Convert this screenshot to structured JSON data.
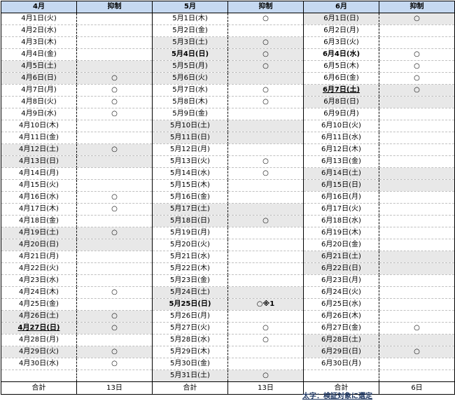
{
  "headers": [
    "4月",
    "抑制",
    "5月",
    "抑制",
    "6月",
    "抑制"
  ],
  "months": [
    {
      "rows": [
        {
          "date": "4月1日(火)",
          "mark": "",
          "gray": false
        },
        {
          "date": "4月2日(水)",
          "mark": "",
          "gray": false
        },
        {
          "date": "4月3日(木)",
          "mark": "",
          "gray": false
        },
        {
          "date": "4月4日(金)",
          "mark": "",
          "gray": false
        },
        {
          "date": "4月5日(土)",
          "mark": "",
          "gray": true
        },
        {
          "date": "4月6日(日)",
          "mark": "○",
          "gray": true
        },
        {
          "date": "4月7日(月)",
          "mark": "○",
          "gray": false
        },
        {
          "date": "4月8日(火)",
          "mark": "○",
          "gray": false
        },
        {
          "date": "4月9日(水)",
          "mark": "○",
          "gray": false
        },
        {
          "date": "4月10日(木)",
          "mark": "",
          "gray": false
        },
        {
          "date": "4月11日(金)",
          "mark": "",
          "gray": false
        },
        {
          "date": "4月12日(土)",
          "mark": "○",
          "gray": true
        },
        {
          "date": "4月13日(日)",
          "mark": "",
          "gray": true
        },
        {
          "date": "4月14日(月)",
          "mark": "",
          "gray": false
        },
        {
          "date": "4月15日(火)",
          "mark": "",
          "gray": false
        },
        {
          "date": "4月16日(水)",
          "mark": "○",
          "gray": false
        },
        {
          "date": "4月17日(木)",
          "mark": "○",
          "gray": false
        },
        {
          "date": "4月18日(金)",
          "mark": "",
          "gray": false
        },
        {
          "date": "4月19日(土)",
          "mark": "○",
          "gray": true
        },
        {
          "date": "4月20日(日)",
          "mark": "",
          "gray": true
        },
        {
          "date": "4月21日(月)",
          "mark": "",
          "gray": false
        },
        {
          "date": "4月22日(火)",
          "mark": "",
          "gray": false
        },
        {
          "date": "4月23日(水)",
          "mark": "",
          "gray": false
        },
        {
          "date": "4月24日(木)",
          "mark": "○",
          "gray": false
        },
        {
          "date": "4月25日(金)",
          "mark": "",
          "gray": false
        },
        {
          "date": "4月26日(土)",
          "mark": "○",
          "gray": true
        },
        {
          "date": "4月27日(日)",
          "mark": "○",
          "gray": true,
          "bold": true,
          "underline": true
        },
        {
          "date": "4月28日(月)",
          "mark": "",
          "gray": false
        },
        {
          "date": "4月29日(火)",
          "mark": "○",
          "gray": true
        },
        {
          "date": "4月30日(水)",
          "mark": "○",
          "gray": false
        },
        {
          "date": "",
          "mark": "",
          "gray": false
        }
      ]
    },
    {
      "rows": [
        {
          "date": "5月1日(木)",
          "mark": "○",
          "gray": false
        },
        {
          "date": "5月2日(金)",
          "mark": "",
          "gray": false
        },
        {
          "date": "5月3日(土)",
          "mark": "○",
          "gray": true
        },
        {
          "date": "5月4日(日)",
          "mark": "○",
          "gray": true,
          "bold": true
        },
        {
          "date": "5月5日(月)",
          "mark": "○",
          "gray": true
        },
        {
          "date": "5月6日(火)",
          "mark": "",
          "gray": true
        },
        {
          "date": "5月7日(水)",
          "mark": "○",
          "gray": false
        },
        {
          "date": "5月8日(木)",
          "mark": "○",
          "gray": false
        },
        {
          "date": "5月9日(金)",
          "mark": "",
          "gray": false
        },
        {
          "date": "5月10日(土)",
          "mark": "",
          "gray": true
        },
        {
          "date": "5月11日(日)",
          "mark": "",
          "gray": true
        },
        {
          "date": "5月12日(月)",
          "mark": "",
          "gray": false
        },
        {
          "date": "5月13日(火)",
          "mark": "○",
          "gray": false
        },
        {
          "date": "5月14日(水)",
          "mark": "○",
          "gray": false
        },
        {
          "date": "5月15日(木)",
          "mark": "",
          "gray": false
        },
        {
          "date": "5月16日(金)",
          "mark": "",
          "gray": false
        },
        {
          "date": "5月17日(土)",
          "mark": "",
          "gray": true
        },
        {
          "date": "5月18日(日)",
          "mark": "○",
          "gray": true
        },
        {
          "date": "5月19日(月)",
          "mark": "",
          "gray": false
        },
        {
          "date": "5月20日(火)",
          "mark": "",
          "gray": false
        },
        {
          "date": "5月21日(水)",
          "mark": "",
          "gray": false
        },
        {
          "date": "5月22日(木)",
          "mark": "",
          "gray": false
        },
        {
          "date": "5月23日(金)",
          "mark": "",
          "gray": false
        },
        {
          "date": "5月24日(土)",
          "mark": "",
          "gray": true
        },
        {
          "date": "5月25日(日)",
          "mark": "○※1",
          "gray": true,
          "bold": true
        },
        {
          "date": "5月26日(月)",
          "mark": "",
          "gray": false
        },
        {
          "date": "5月27日(火)",
          "mark": "○",
          "gray": false
        },
        {
          "date": "5月28日(水)",
          "mark": "○",
          "gray": false
        },
        {
          "date": "5月29日(木)",
          "mark": "",
          "gray": false
        },
        {
          "date": "5月30日(金)",
          "mark": "",
          "gray": false
        },
        {
          "date": "5月31日(土)",
          "mark": "○",
          "gray": true
        }
      ]
    },
    {
      "rows": [
        {
          "date": "6月1日(日)",
          "mark": "○",
          "gray": true
        },
        {
          "date": "6月2日(月)",
          "mark": "",
          "gray": false
        },
        {
          "date": "6月3日(火)",
          "mark": "",
          "gray": false
        },
        {
          "date": "6月4日(水)",
          "mark": "○",
          "gray": false,
          "bold": true
        },
        {
          "date": "6月5日(木)",
          "mark": "○",
          "gray": false
        },
        {
          "date": "6月6日(金)",
          "mark": "○",
          "gray": false
        },
        {
          "date": "6月7日(土)",
          "mark": "○",
          "gray": true,
          "bold": true,
          "underline": true
        },
        {
          "date": "6月8日(日)",
          "mark": "",
          "gray": true
        },
        {
          "date": "6月9日(月)",
          "mark": "",
          "gray": false
        },
        {
          "date": "6月10日(火)",
          "mark": "",
          "gray": false
        },
        {
          "date": "6月11日(水)",
          "mark": "",
          "gray": false
        },
        {
          "date": "6月12日(木)",
          "mark": "",
          "gray": false
        },
        {
          "date": "6月13日(金)",
          "mark": "",
          "gray": false
        },
        {
          "date": "6月14日(土)",
          "mark": "",
          "gray": true
        },
        {
          "date": "6月15日(日)",
          "mark": "",
          "gray": true
        },
        {
          "date": "6月16日(月)",
          "mark": "",
          "gray": false
        },
        {
          "date": "6月17日(火)",
          "mark": "",
          "gray": false
        },
        {
          "date": "6月18日(水)",
          "mark": "",
          "gray": false
        },
        {
          "date": "6月19日(木)",
          "mark": "",
          "gray": false
        },
        {
          "date": "6月20日(金)",
          "mark": "",
          "gray": false
        },
        {
          "date": "6月21日(土)",
          "mark": "",
          "gray": true
        },
        {
          "date": "6月22日(日)",
          "mark": "",
          "gray": true
        },
        {
          "date": "6月23日(月)",
          "mark": "",
          "gray": false
        },
        {
          "date": "6月24日(火)",
          "mark": "",
          "gray": false
        },
        {
          "date": "6月25日(水)",
          "mark": "",
          "gray": false
        },
        {
          "date": "6月26日(木)",
          "mark": "",
          "gray": false
        },
        {
          "date": "6月27日(金)",
          "mark": "○",
          "gray": false
        },
        {
          "date": "6月28日(土)",
          "mark": "",
          "gray": true
        },
        {
          "date": "6月29日(日)",
          "mark": "○",
          "gray": true
        },
        {
          "date": "6月30日(月)",
          "mark": "",
          "gray": false
        },
        {
          "date": "",
          "mark": "",
          "gray": false
        }
      ]
    }
  ],
  "totals": {
    "label": "合計",
    "apr": "13日",
    "may": "13日",
    "jun": "6日"
  },
  "note": "太字：検証対象に選定"
}
